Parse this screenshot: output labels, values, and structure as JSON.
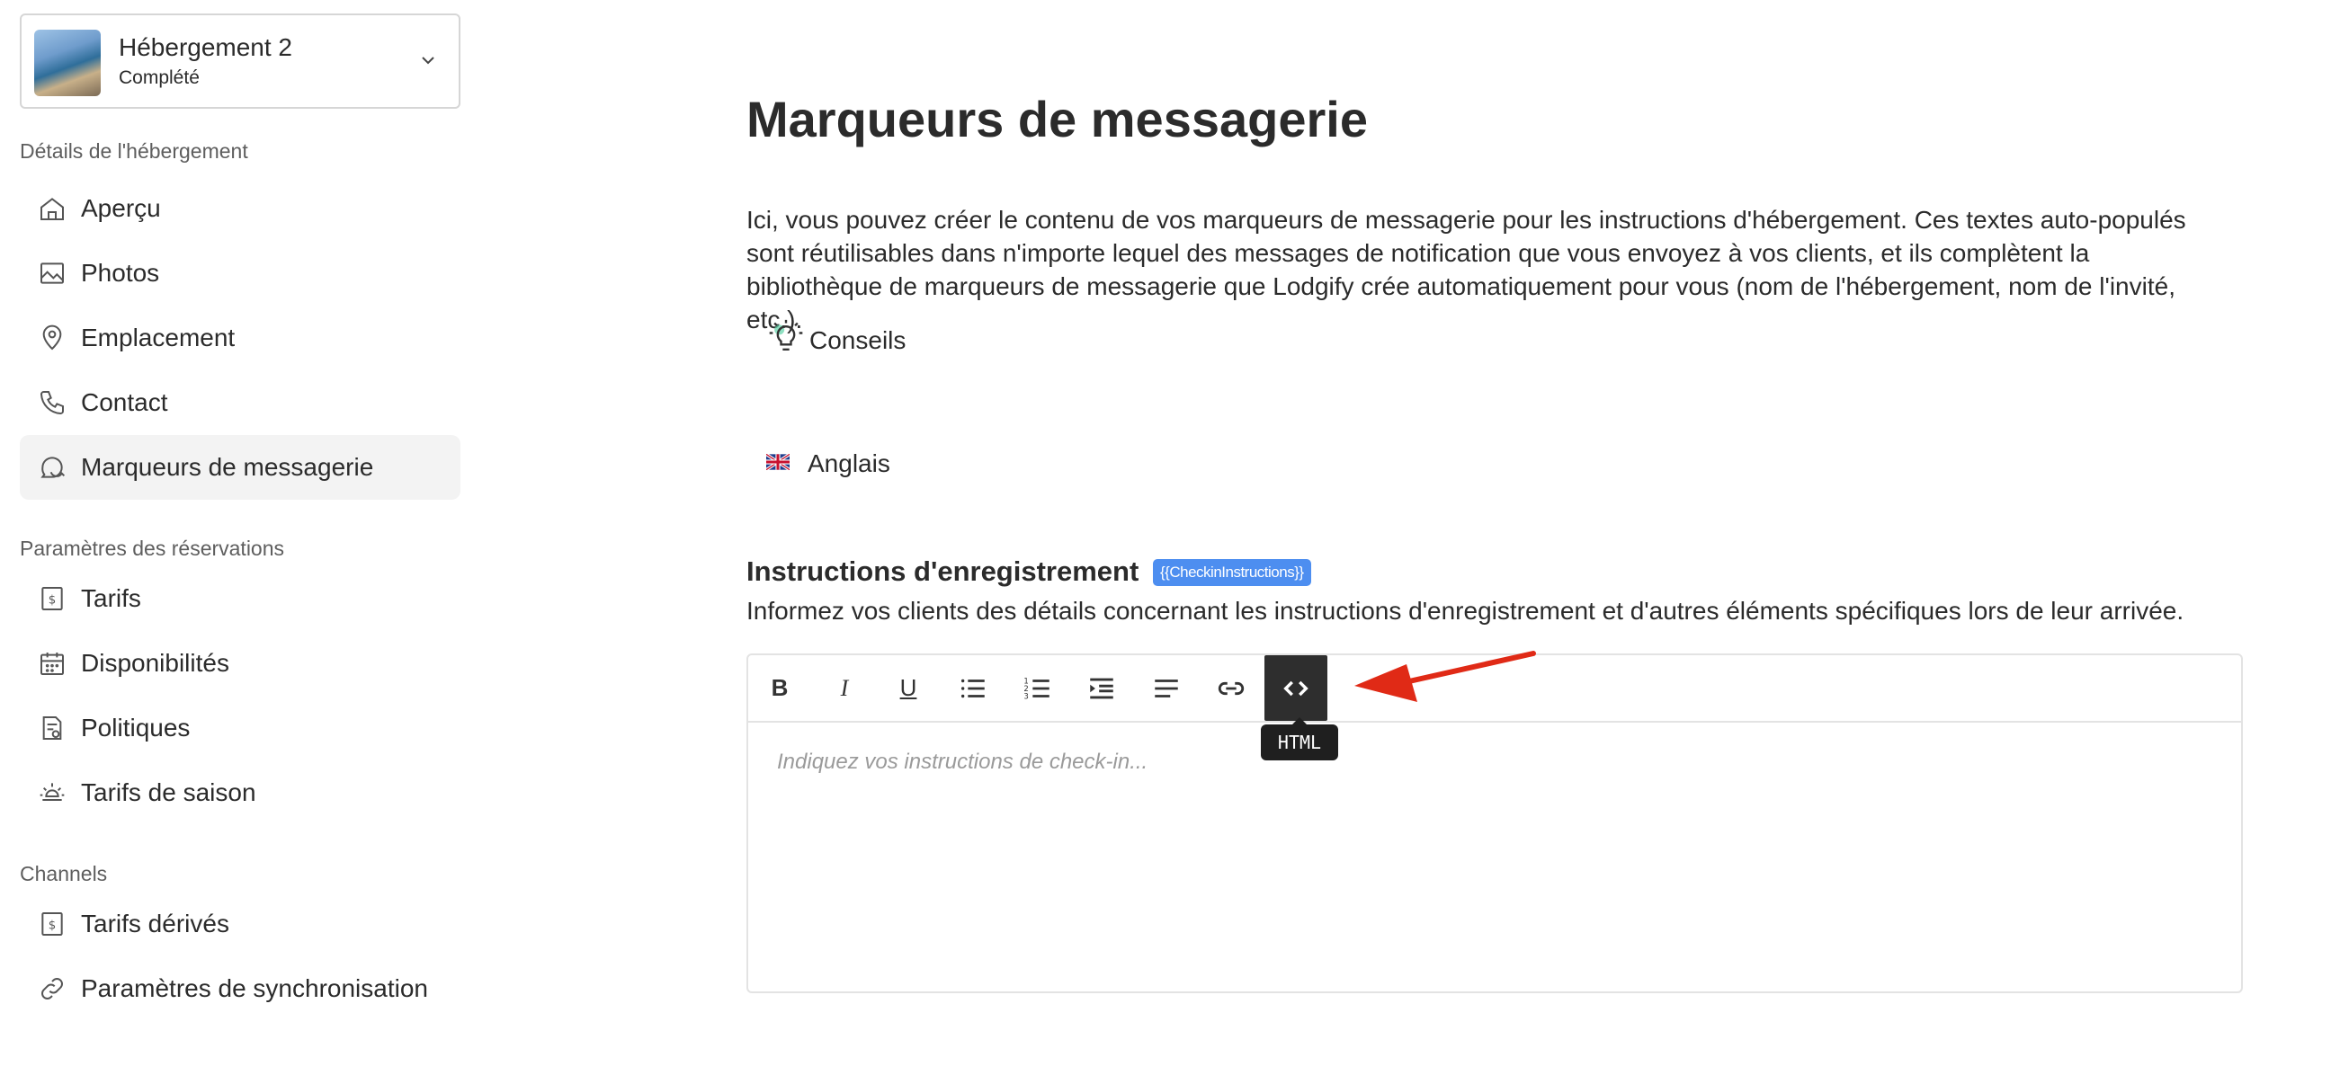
{
  "property": {
    "name": "Hébergement 2",
    "status": "Complété"
  },
  "sidebar": {
    "sections": [
      {
        "title": "Détails de l'hébergement",
        "items": [
          {
            "label": "Aperçu",
            "icon": "home-icon"
          },
          {
            "label": "Photos",
            "icon": "image-icon"
          },
          {
            "label": "Emplacement",
            "icon": "map-pin-icon"
          },
          {
            "label": "Contact",
            "icon": "phone-icon"
          },
          {
            "label": "Marqueurs de messagerie",
            "icon": "chat-icon",
            "active": true
          }
        ]
      },
      {
        "title": "Paramètres des réservations",
        "items": [
          {
            "label": "Tarifs",
            "icon": "price-icon"
          },
          {
            "label": "Disponibilités",
            "icon": "calendar-icon"
          },
          {
            "label": "Politiques",
            "icon": "policy-icon"
          },
          {
            "label": "Tarifs de saison",
            "icon": "sun-icon"
          }
        ]
      },
      {
        "title": "Channels",
        "items": [
          {
            "label": "Tarifs dérivés",
            "icon": "price-icon"
          },
          {
            "label": "Paramètres de synchronisation",
            "icon": "link-icon"
          }
        ]
      }
    ]
  },
  "main": {
    "title": "Marqueurs de messagerie",
    "intro": "Ici, vous pouvez créer le contenu de vos marqueurs de messagerie pour les instructions d'hébergement. Ces textes auto-populés sont réutilisables dans n'importe lequel des messages de notification que vous envoyez à vos clients, et ils complètent la bibliothèque de marqueurs de messagerie que Lodgify crée automatiquement pour vous (nom de l'hébergement, nom de l'invité, etc.).",
    "tips_label": "Conseils",
    "language": "Anglais",
    "checkin": {
      "title": "Instructions d'enregistrement",
      "tag": "{{CheckinInstructions}}",
      "description": "Informez vos clients des détails concernant les instructions d'enregistrement et d'autres éléments spécifiques lors de leur arrivée.",
      "placeholder": "Indiquez vos instructions de check-in..."
    },
    "toolbar": {
      "bold": "B",
      "italic": "I",
      "underline": "U",
      "html_tooltip": "HTML"
    }
  },
  "colors": {
    "accent_tag": "#4d8ef0",
    "arrow": "#e02a16",
    "active_tool": "#2e2e2e"
  }
}
